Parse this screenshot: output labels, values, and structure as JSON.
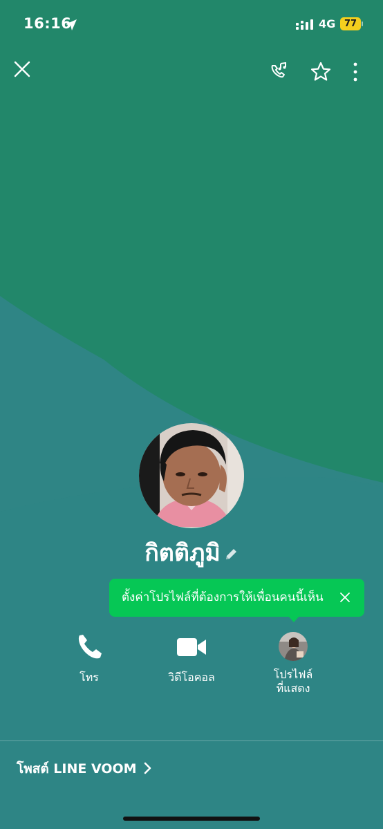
{
  "status_bar": {
    "time": "16:16",
    "network": "4G",
    "battery": "77",
    "battery_color": "#f4cf1e"
  },
  "top_bar": {
    "icons": [
      "close-icon",
      "ringtone-icon",
      "star-icon",
      "more-icon"
    ]
  },
  "profile": {
    "name": "กิตติภูมิ"
  },
  "tooltip": {
    "text": "ตั้งค่าโปรไฟล์ที่ต้องการให้เพื่อนคนนี้เห็น",
    "color": "#06c755"
  },
  "actions": [
    {
      "label": "โทร",
      "icon": "phone-icon"
    },
    {
      "label": "วิดีโอคอล",
      "icon": "video-camera-icon"
    },
    {
      "label_line1": "โปรไฟล์",
      "label_line2": "ที่แสดง",
      "icon": "profile-thumbnail"
    }
  ],
  "voom": {
    "label": "โพสต์ LINE VOOM"
  },
  "colors": {
    "background_top": "#22876a",
    "background_bottom": "#2f8585"
  }
}
